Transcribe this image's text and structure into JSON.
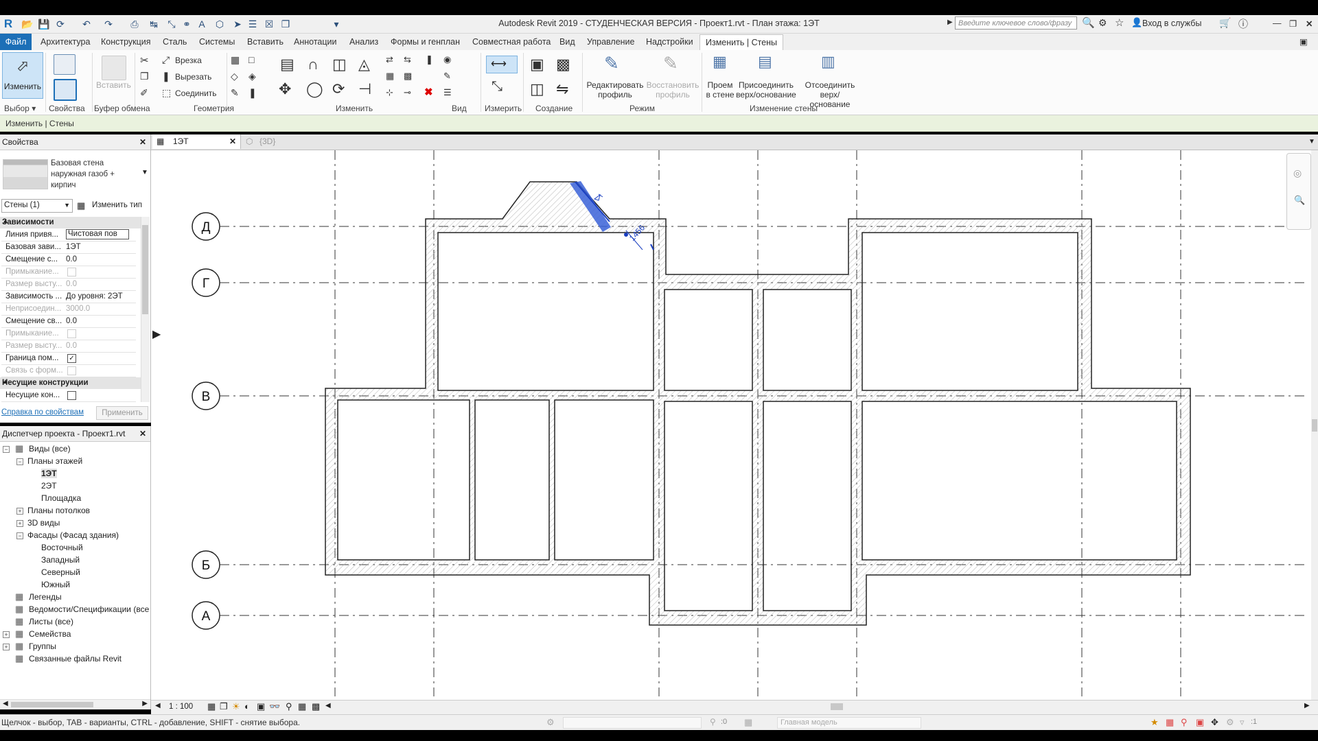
{
  "window": {
    "title": "Autodesk Revit 2019 - СТУДЕНЧЕСКАЯ ВЕРСИЯ - Проект1.rvt - План этажа: 1ЭТ",
    "search_placeholder": "Введите ключевое слово/фразу",
    "sign_in": "Вход в службы"
  },
  "ribbon_tabs": [
    "Файл",
    "Архитектура",
    "Конструкция",
    "Сталь",
    "Системы",
    "Вставить",
    "Аннотации",
    "Анализ",
    "Формы и генплан",
    "Совместная работа",
    "Вид",
    "Управление",
    "Надстройки",
    "Изменить | Стены"
  ],
  "ribbon": {
    "modify_label": "Изменить",
    "paste_label": "Вставить",
    "cut_label": "Врезка",
    "cutout_label": "Вырезать",
    "join_label": "Соединить",
    "edit_profile": "Редактировать профиль",
    "reset_profile": "Восстановить профиль",
    "wall_opening": "Проем в стене",
    "attach": "Присоединить верх/основание",
    "detach": "Отсоединить верх/основание",
    "groups": [
      "Выбор",
      "Свойства",
      "Буфер обмена",
      "Геометрия",
      "Изменить",
      "Вид",
      "Измерить",
      "Создание",
      "Режим",
      "Изменение стены"
    ]
  },
  "context_bar": "Изменить | Стены",
  "properties": {
    "title": "Свойства",
    "type_name": "Базовая стена наружная газоб + кирпич",
    "instance_filter": "Стены (1)",
    "edit_type": "Изменить тип",
    "sections": [
      {
        "name": "Зависимости",
        "rows": [
          {
            "k": "Линия привя...",
            "v": "Чистовая пов",
            "dis": false,
            "box": true
          },
          {
            "k": "Базовая зави...",
            "v": "1ЭТ",
            "dis": false
          },
          {
            "k": "Смещение с...",
            "v": "0.0",
            "dis": false
          },
          {
            "k": "Примыкание...",
            "v": "",
            "dis": true,
            "chk": "empty"
          },
          {
            "k": "Размер высту...",
            "v": "0.0",
            "dis": true
          },
          {
            "k": "Зависимость ...",
            "v": "До уровня: 2ЭТ",
            "dis": false
          },
          {
            "k": "Неприсоедин...",
            "v": "3000.0",
            "dis": true
          },
          {
            "k": "Смещение св...",
            "v": "0.0",
            "dis": false
          },
          {
            "k": "Примыкание...",
            "v": "",
            "dis": true,
            "chk": "empty"
          },
          {
            "k": "Размер высту...",
            "v": "0.0",
            "dis": true
          },
          {
            "k": "Граница пом...",
            "v": "",
            "dis": false,
            "chk": "checked"
          },
          {
            "k": "Связь с форм...",
            "v": "",
            "dis": true,
            "chk": "empty"
          }
        ]
      },
      {
        "name": "Несущие конструкции",
        "rows": [
          {
            "k": "Несущие кон...",
            "v": "",
            "dis": false,
            "chk": "empty"
          }
        ]
      }
    ],
    "help_link": "Справка по свойствам",
    "apply": "Применить"
  },
  "browser": {
    "title": "Диспетчер проекта - Проект1.rvt",
    "items": [
      {
        "text": "Виды (все)",
        "lvl": 0,
        "exp": "−"
      },
      {
        "text": "Планы этажей",
        "lvl": 1,
        "exp": "−"
      },
      {
        "text": "1ЭТ",
        "lvl": 2,
        "bold": true
      },
      {
        "text": "2ЭТ",
        "lvl": 2
      },
      {
        "text": "Площадка",
        "lvl": 2
      },
      {
        "text": "Планы потолков",
        "lvl": 1,
        "exp": "+"
      },
      {
        "text": "3D виды",
        "lvl": 1,
        "exp": "+"
      },
      {
        "text": "Фасады (Фасад здания)",
        "lvl": 1,
        "exp": "−"
      },
      {
        "text": "Восточный",
        "lvl": 2
      },
      {
        "text": "Западный",
        "lvl": 2
      },
      {
        "text": "Северный",
        "lvl": 2
      },
      {
        "text": "Южный",
        "lvl": 2
      },
      {
        "text": "Легенды",
        "lvl": 0
      },
      {
        "text": "Ведомости/Спецификации (все",
        "lvl": 0
      },
      {
        "text": "Листы (все)",
        "lvl": 0
      },
      {
        "text": "Семейства",
        "lvl": 0,
        "exp": "+"
      },
      {
        "text": "Группы",
        "lvl": 0,
        "exp": "+"
      },
      {
        "text": "Связанные файлы Revit",
        "lvl": 0
      }
    ]
  },
  "view_tabs": [
    {
      "label": "1ЭТ",
      "active": true
    },
    {
      "label": "{3D}",
      "active": false
    }
  ],
  "grid_labels": [
    "Д",
    "Г",
    "В",
    "Б",
    "А"
  ],
  "dimension_text": "1456",
  "view_scale": "1 : 100",
  "status_message": "Щелчок - выбор, TAB - варианты, CTRL - добавление, SHIFT - снятие выбора.",
  "workset": "Главная модель",
  "selection_count": ":0",
  "filter_count": ":1",
  "colors": {
    "selection": "#3a62d8",
    "accent": "#1c6fb7",
    "context": "#eaf2de"
  }
}
